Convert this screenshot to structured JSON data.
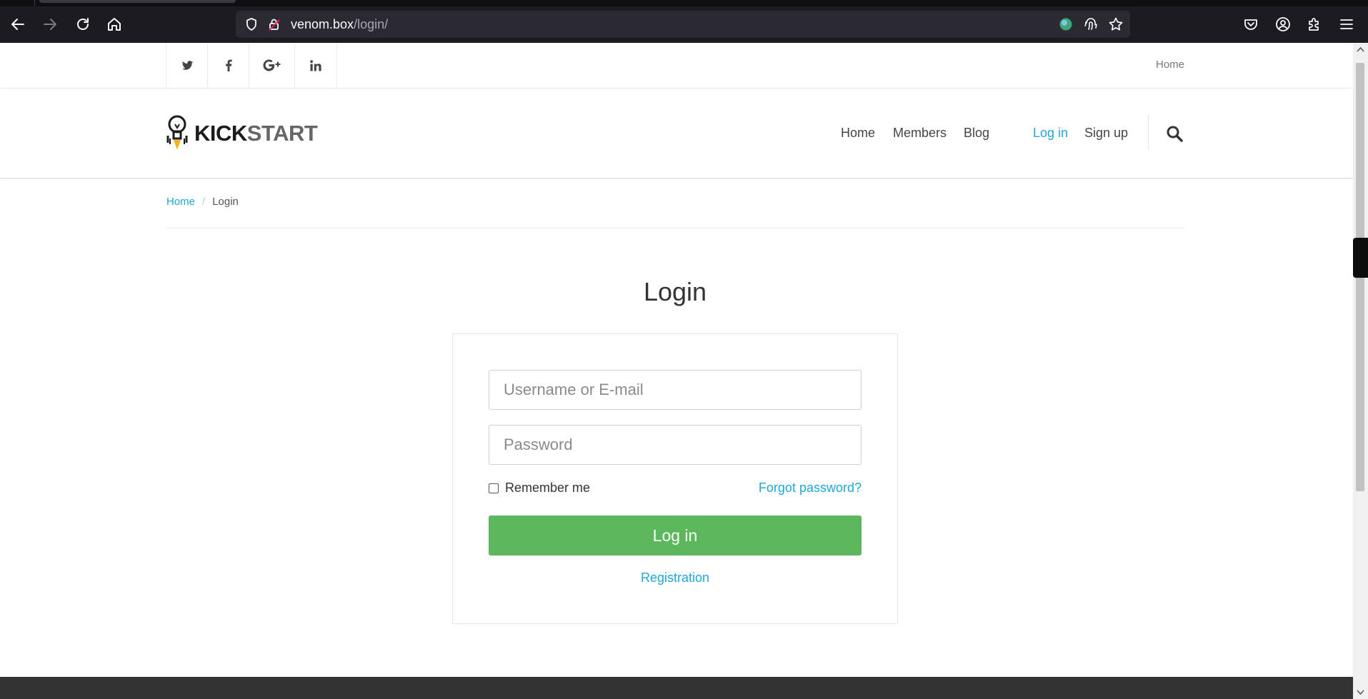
{
  "browser": {
    "url_host": "venom.box",
    "url_path": "/login/",
    "icons": [
      "back-arrow-icon",
      "forward-arrow-icon",
      "reload-icon",
      "home-icon",
      "shield-icon",
      "insecure-lock-icon",
      "globe-extension-icon",
      "fingerprint-icon",
      "star-icon",
      "pocket-icon",
      "account-icon",
      "extensions-icon",
      "menu-icon"
    ]
  },
  "topbar": {
    "social": [
      "twitter-icon",
      "facebook-icon",
      "google-plus-icon",
      "linkedin-icon"
    ],
    "home_link": "Home"
  },
  "header": {
    "logo_bold": "KICK",
    "logo_light": "START",
    "nav": {
      "home": "Home",
      "members": "Members",
      "blog": "Blog",
      "login": "Log in",
      "signup": "Sign up"
    }
  },
  "breadcrumb": {
    "home": "Home",
    "separator": "/",
    "current": "Login"
  },
  "login": {
    "title": "Login",
    "username_placeholder": "Username or E-mail",
    "password_placeholder": "Password",
    "remember_label": "Remember me",
    "forgot_label": "Forgot password?",
    "submit_label": "Log in",
    "register_label": "Registration"
  },
  "colors": {
    "accent": "#1ea7d6",
    "button": "#5cb85c",
    "footer": "#333333"
  }
}
